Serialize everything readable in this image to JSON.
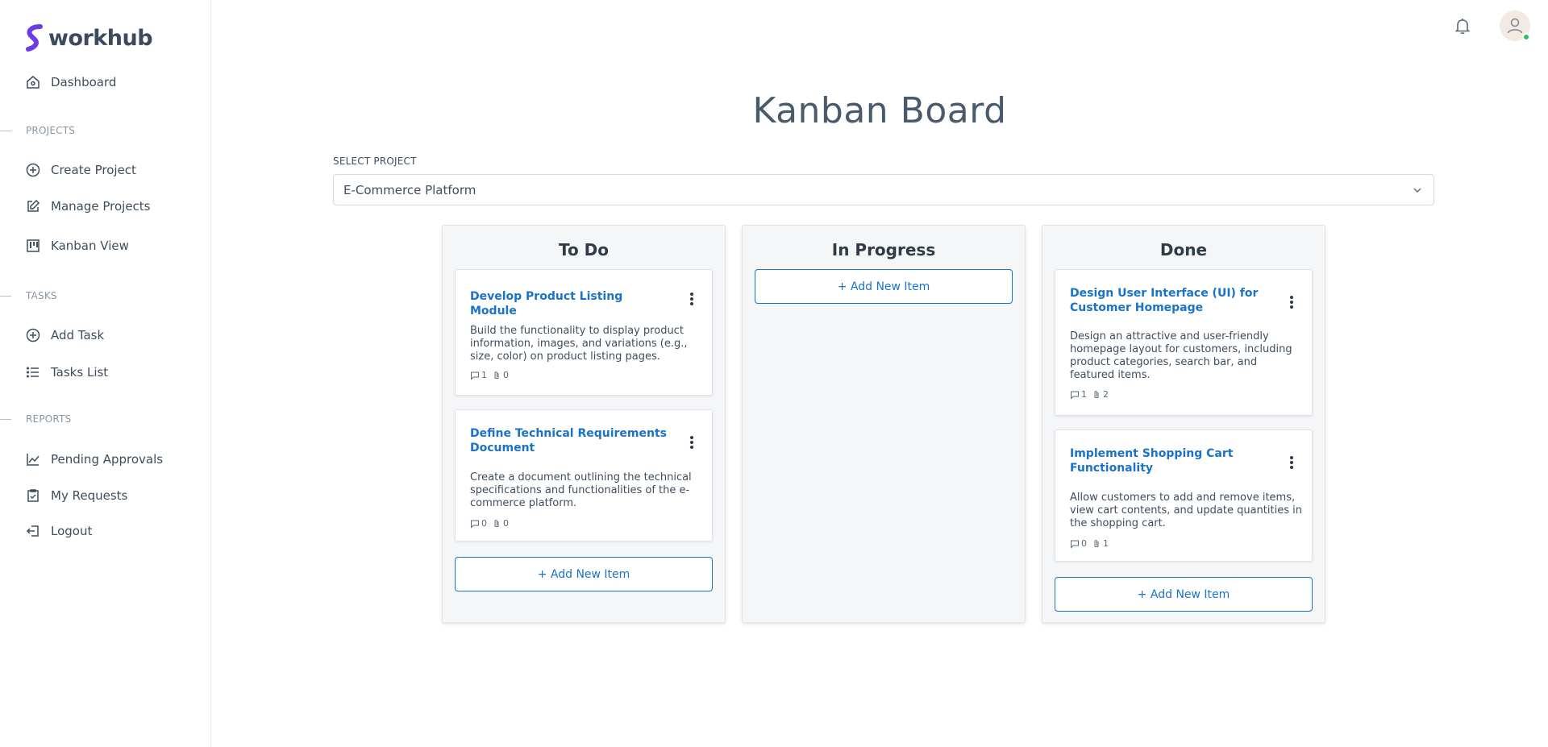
{
  "app": {
    "brand": "workhub"
  },
  "sidebar": {
    "dashboard": "Dashboard",
    "sections": {
      "projects": "PROJECTS",
      "tasks": "TASKS",
      "reports": "REPORTS"
    },
    "items": {
      "create_project": "Create Project",
      "manage_projects": "Manage Projects",
      "kanban_view": "Kanban View",
      "add_task": "Add Task",
      "tasks_list": "Tasks List",
      "pending_approvals": "Pending Approvals",
      "my_requests": "My Requests",
      "logout": "Logout"
    }
  },
  "header": {
    "bell_icon": "bell-icon",
    "avatar_icon": "user-icon",
    "status_color": "#22c55e"
  },
  "page": {
    "title": "Kanban Board",
    "select_label": "SELECT PROJECT",
    "selected_project": "E-Commerce Platform"
  },
  "colors": {
    "accent": "#1a73c8",
    "column_bg": "#f5f6f8"
  },
  "columns": [
    {
      "title": "To Do",
      "add_label": "+ Add New Item",
      "cards": [
        {
          "title": "Develop Product Listing Module",
          "description": "Build the functionality to display product information, images, and variations (e.g., size, color) on product listing pages.",
          "comments": "1",
          "attachments": "0"
        },
        {
          "title": "Define Technical Requirements Document",
          "description": "Create a document outlining the technical specifications and functionalities of the e-commerce platform.",
          "comments": "0",
          "attachments": "0"
        }
      ]
    },
    {
      "title": "In Progress",
      "add_label": "+ Add New Item",
      "cards": []
    },
    {
      "title": "Done",
      "add_label": "+ Add New Item",
      "cards": [
        {
          "title": "Design User Interface (UI) for Customer Homepage",
          "description": "Design an attractive and user-friendly homepage layout for customers, including product categories, search bar, and featured items.",
          "comments": "1",
          "attachments": "2"
        },
        {
          "title": "Implement Shopping Cart Functionality",
          "description": "Allow customers to add and remove items, view cart contents, and update quantities in the shopping cart.",
          "comments": "0",
          "attachments": "1"
        }
      ]
    }
  ]
}
